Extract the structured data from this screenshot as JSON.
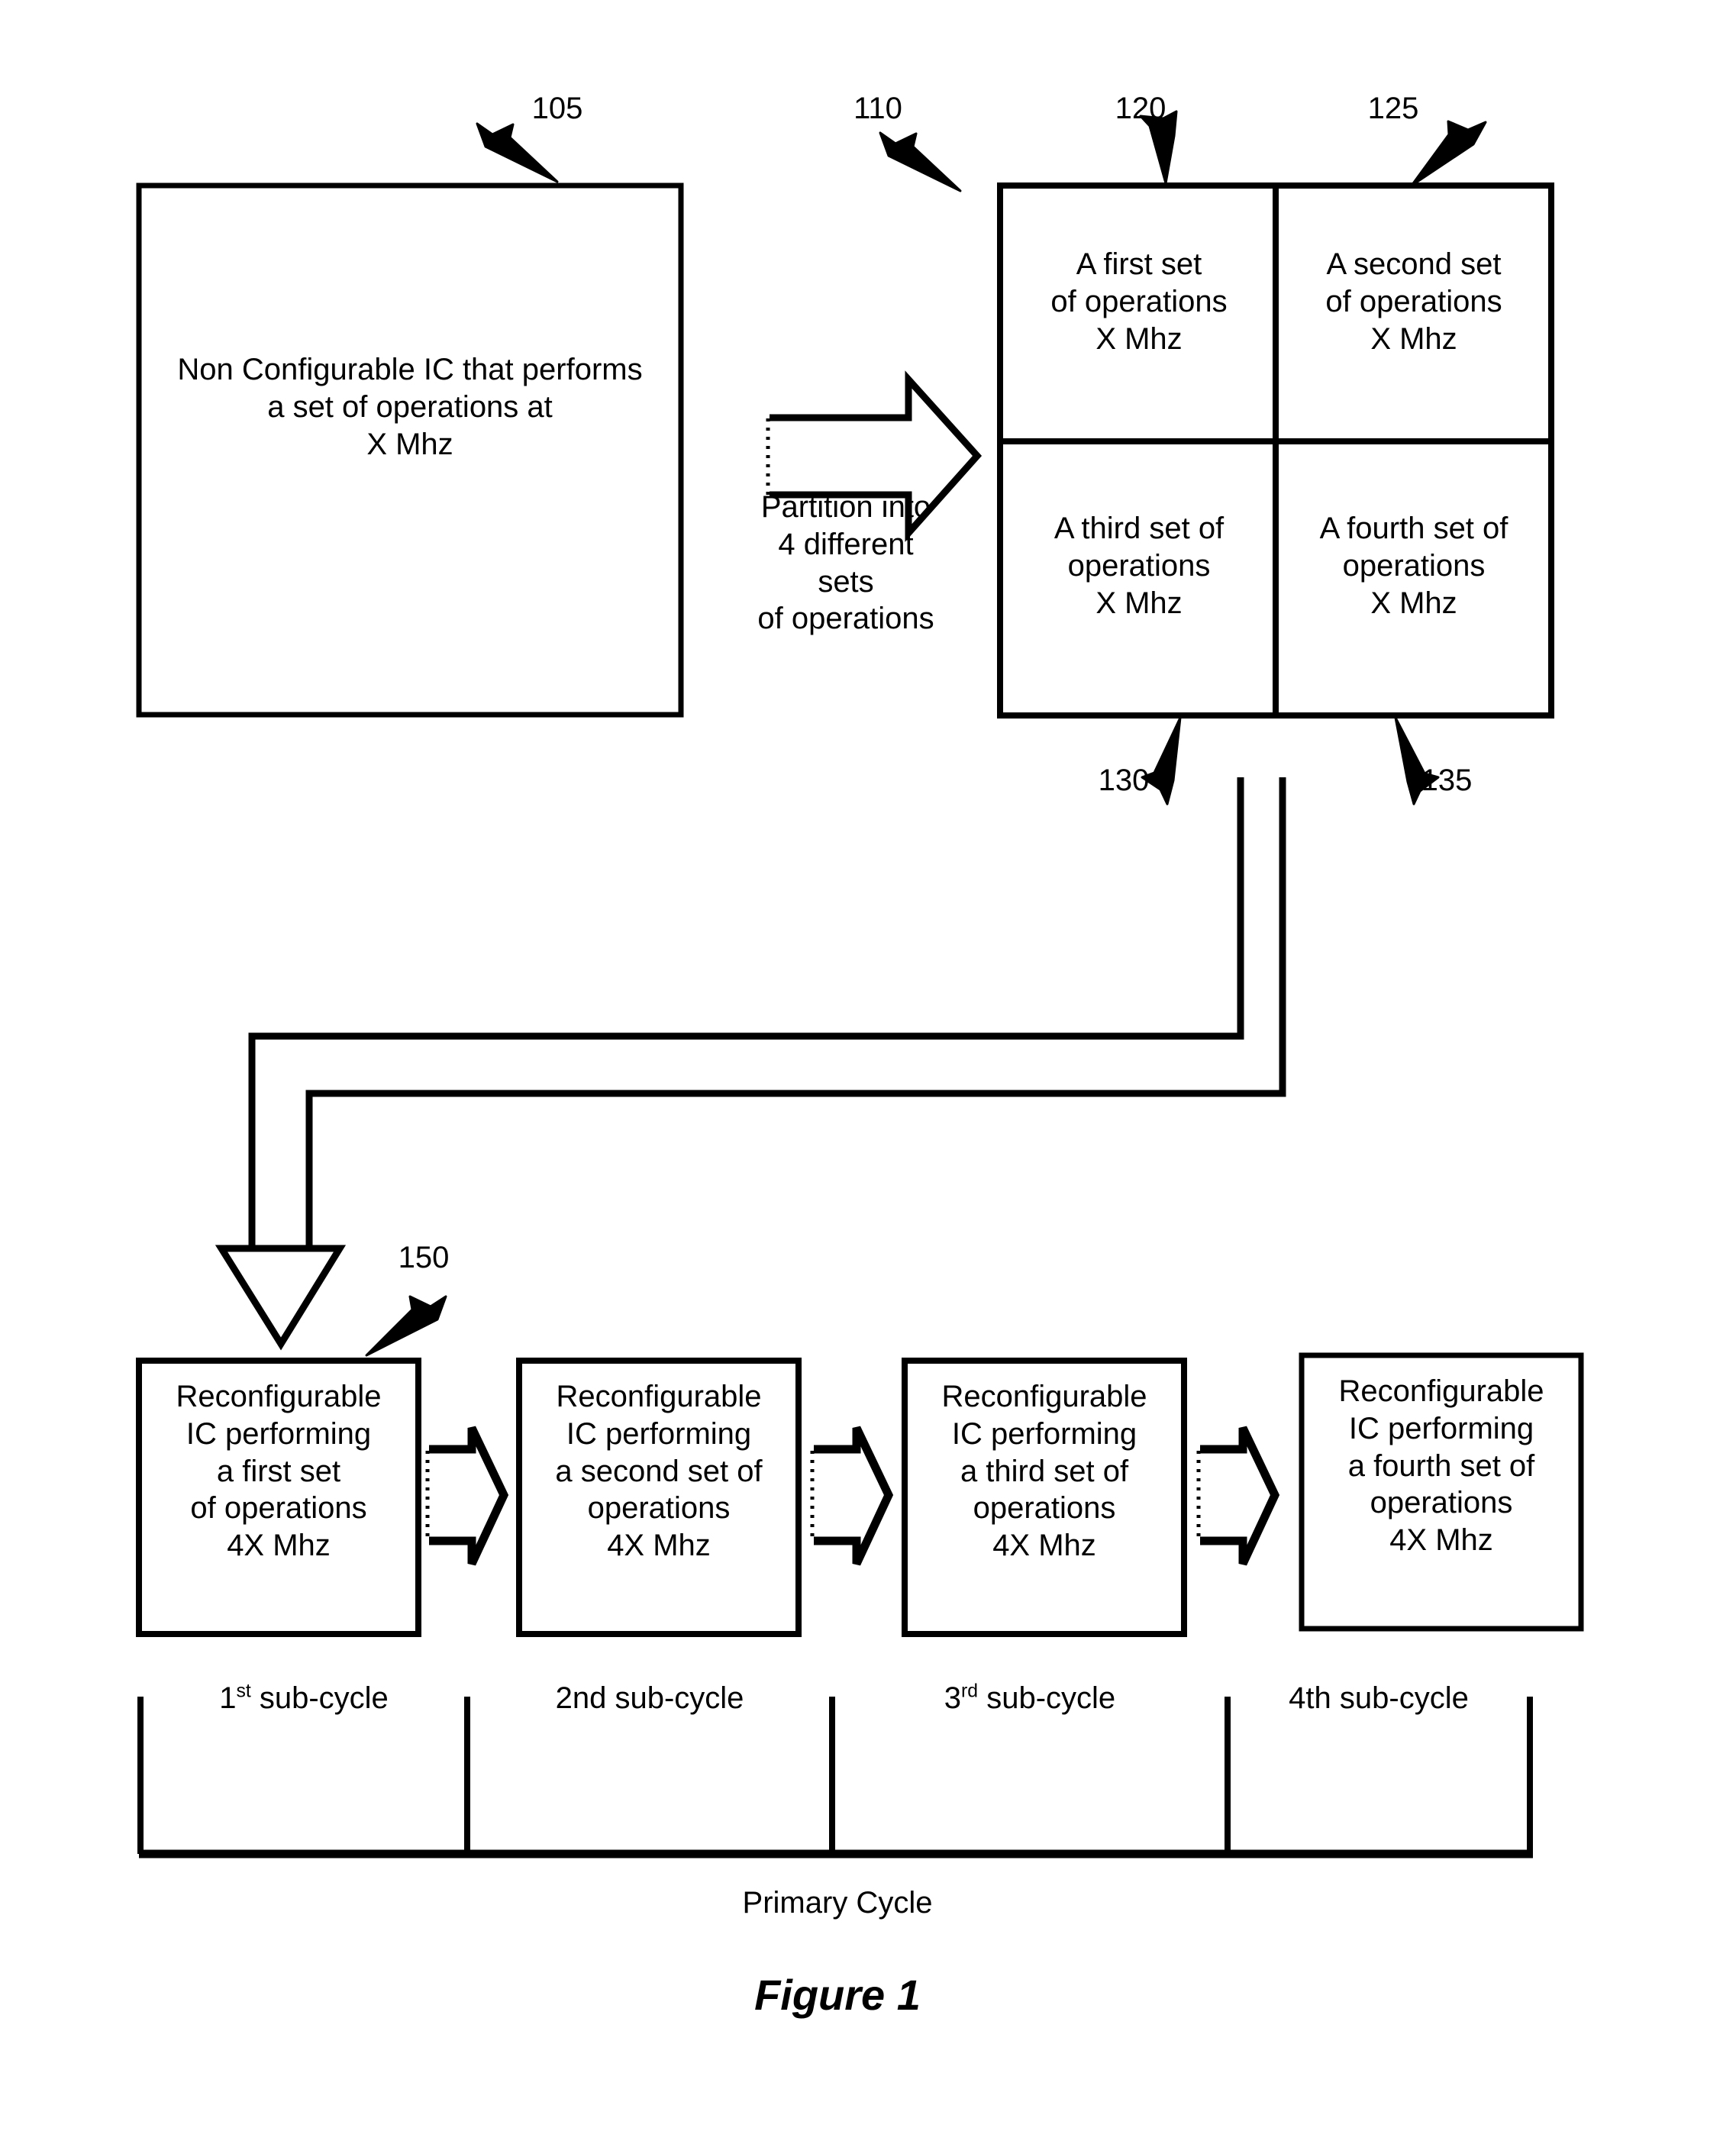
{
  "figure": {
    "caption": "Figure 1",
    "primary_cycle_label": "Primary Cycle"
  },
  "source_block": {
    "ref": "105",
    "text": "Non Configurable IC that performs\na set of operations at\nX Mhz",
    "lines": [
      "Non Configurable IC that",
      "performs",
      "a set of operations at",
      "X Mhz"
    ]
  },
  "partition_arrow": {
    "ref": "110",
    "label": "Partition into\n4 different\nsets\nof operations",
    "lines": [
      "Partition into",
      "4 different",
      "sets",
      "of operations"
    ]
  },
  "partition_grid": {
    "cells": [
      {
        "ref": "120",
        "lines": [
          "A first set",
          "of operations",
          "X Mhz"
        ],
        "text": "A first set\nof operations\nX Mhz"
      },
      {
        "ref": "125",
        "lines": [
          "A second set",
          "of operations",
          "X Mhz"
        ],
        "text": "A second set\nof operations\nX Mhz"
      },
      {
        "ref": "130",
        "lines": [
          "A third set of",
          "operations",
          "X Mhz"
        ],
        "text": "A third set of\noperations\nX Mhz"
      },
      {
        "ref": "135",
        "lines": [
          "A fourth set of",
          "operations",
          "X Mhz"
        ],
        "text": "A fourth set of\noperations\nX Mhz"
      }
    ]
  },
  "reconfigurable_row": {
    "ref": "150",
    "boxes": [
      {
        "lines": [
          "Reconfigurable",
          "IC performing",
          "a first set",
          "of operations",
          "4X Mhz"
        ],
        "text": "Reconfigurable\nIC performing\na first set\nof operations\n4X Mhz"
      },
      {
        "lines": [
          "Reconfigurable",
          "IC performing",
          "a second set of",
          "operations",
          "4X Mhz"
        ],
        "text": "Reconfigurable\nIC performing\na second set of\noperations\n4X Mhz"
      },
      {
        "lines": [
          "Reconfigurable",
          "IC performing",
          "a third set of",
          "operations",
          "4X Mhz"
        ],
        "text": "Reconfigurable\nIC performing\na third set of\noperations\n4X Mhz"
      },
      {
        "lines": [
          "Reconfigurable",
          "IC performing",
          "a fourth set of",
          "operations",
          "4X Mhz"
        ],
        "text": "Reconfigurable\nIC performing\na fourth set of\noperations\n4X Mhz"
      }
    ]
  },
  "timeline": {
    "segments": [
      {
        "ordinal": "1",
        "suffix": "st",
        "label": "sub-cycle",
        "superscript": true
      },
      {
        "ordinal": "2nd",
        "suffix": "",
        "label": "sub-cycle",
        "superscript": false
      },
      {
        "ordinal": "3",
        "suffix": "rd",
        "label": "sub-cycle",
        "superscript": true
      },
      {
        "ordinal": "4th",
        "suffix": "",
        "label": "sub-cycle",
        "superscript": false
      }
    ],
    "total_label": "Primary Cycle"
  },
  "colors": {
    "stroke": "#000000",
    "background": "#ffffff"
  }
}
